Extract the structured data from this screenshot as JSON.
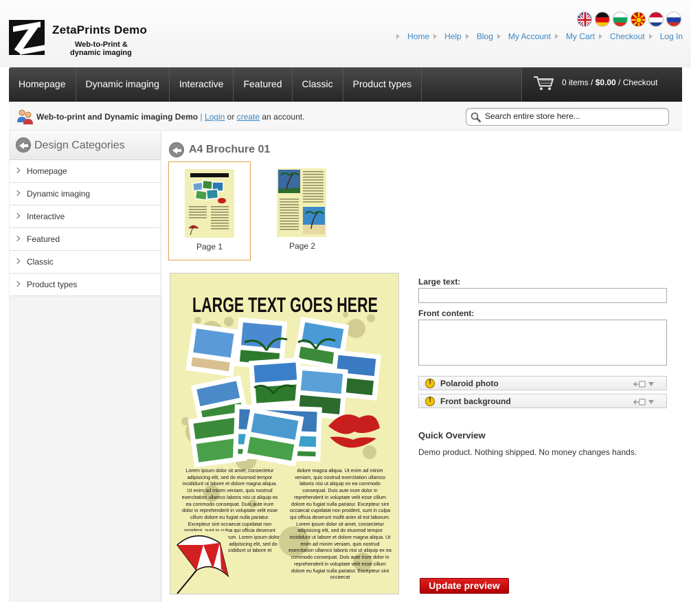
{
  "header": {
    "brand_title": "ZetaPrints Demo",
    "brand_sub_1": "Web-to-Print &",
    "brand_sub_2": "dynamic imaging",
    "languages": [
      "english-flag-icon",
      "german-flag-icon",
      "bulgarian-flag-icon",
      "macedonian-flag-icon",
      "dutch-flag-icon",
      "russian-flag-icon"
    ],
    "links": [
      "Home",
      "Help",
      "Blog",
      "My Account",
      "My Cart",
      "Checkout",
      "Log In"
    ]
  },
  "nav": {
    "items": [
      "Homepage",
      "Dynamic imaging",
      "Interactive",
      "Featured",
      "Classic",
      "Product types"
    ],
    "cart_count": "0 items",
    "cart_sep": " / ",
    "cart_total": "$0.00",
    "cart_checkout": " / Checkout"
  },
  "subbar": {
    "welcome": "Web-to-print and Dynamic imaging Demo",
    "separator": "|",
    "login": "Login",
    "or": "or",
    "create": "create",
    "account": "an account.",
    "search_placeholder": "Search entire store here..."
  },
  "sidebar": {
    "title": "Design Categories",
    "items": [
      "Homepage",
      "Dynamic imaging",
      "Interactive",
      "Featured",
      "Classic",
      "Product types"
    ]
  },
  "product": {
    "title": "A4 Brochure 01",
    "pages": [
      "Page 1",
      "Page 2"
    ],
    "preview_headline": "LARGE TEXT GOES HERE",
    "lorem_left": "Lorem ipsum dolor sit amet, consectetur adipisicing elit, sed do eiusmod tempor incididunt ut labore et dolore magna aliqua. Ut enim ad minim veniam, quis nostrud exercitation ullamco laboris nisi ut aliquip ex ea commodo consequat. Duis aute irure dolor in reprehenderit in voluptate velit esse cillum dolore eu fugiat nulla pariatur. Excepteur sint occaecat cupidatat non proident, sunt in culpa qui officia deserunt mollit anim id est laborum. Lorem ipsum dolor sit amet, consectetur adipisicing elit, sed do eiusmod tempor incididunt ut labore et",
    "lorem_right": "dolore magna aliqua. Ut enim ad minim veniam, quis nostrud exercitation ullamco laboris nisi ut aliquip ex ea commodo consequat. Duis aute irure dolor in reprehenderit in voluptate velit esse cillum dolore eu fugiat nulla pariatur. Excepteur sint occaecat cupidatat non proident, sunt in culpa qui officia deserunt mollit anim id est laborum. Lorem ipsum dolor sit amet, consectetur adipisicing elit, sed do eiusmod tempor incididunt ut labore et dolore magna aliqua. Ut enim ad minim veniam, quis nostrud exercitation ullamco laboris nisi ut aliquip ex ea commodo consequat. Duis aute irure dolor in reprehenderit in voluptate velit esse cillum dolore eu fugiat nulla pariatur. Excepteur sint occaecat"
  },
  "form": {
    "large_text_label": "Large text:",
    "large_text_value": "",
    "front_content_label": "Front content:",
    "front_content_value": "",
    "image_fields": [
      "Polaroid photo",
      "Front background"
    ],
    "quick_overview_title": "Quick Overview",
    "quick_overview_text": "Demo product. Nothing shipped. No money changes hands.",
    "update_button": "Update preview"
  },
  "colors": {
    "link": "#3c86c4",
    "nav_bg": "#2e2e2e",
    "accent_red": "#c40000",
    "brochure_bg": "#f2efb4",
    "thumb_border": "#e2a24a"
  }
}
